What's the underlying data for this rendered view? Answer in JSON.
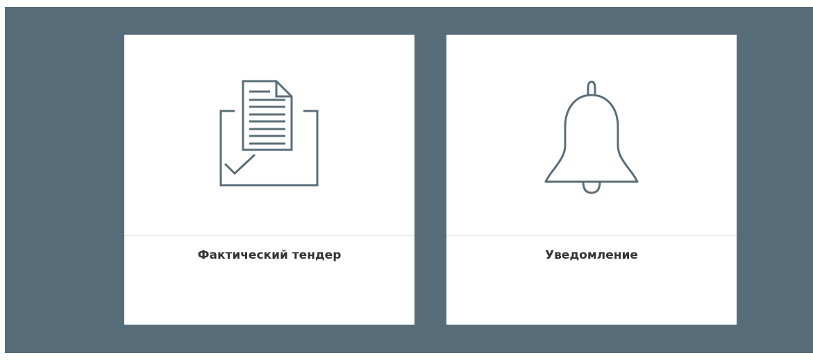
{
  "tiles": [
    {
      "label": "Фактический тендер",
      "icon": "document-checkbox-icon"
    },
    {
      "label": "Уведомление",
      "icon": "bell-icon"
    }
  ],
  "colors": {
    "background_panel": "#566d79",
    "tile_background": "#ffffff",
    "icon_stroke": "#5a6d78",
    "label_text": "#333333",
    "divider": "#e6e9eb"
  }
}
